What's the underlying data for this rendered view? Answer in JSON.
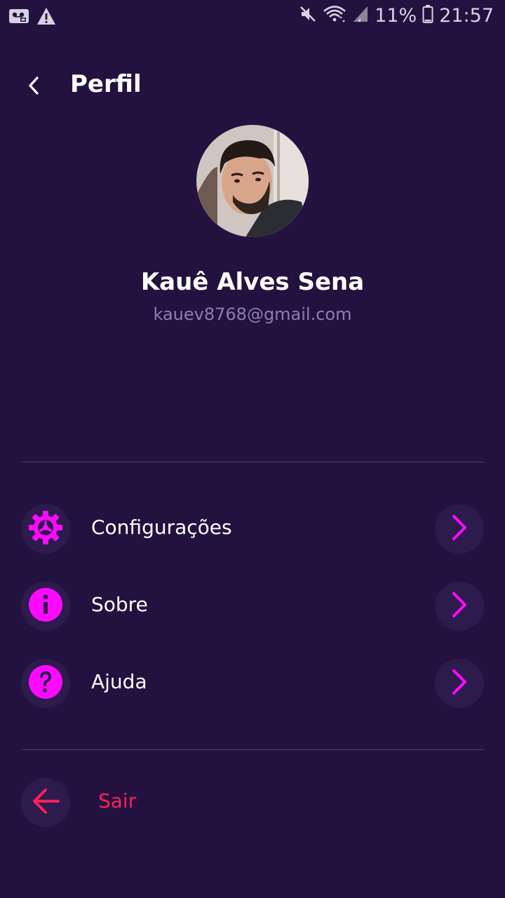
{
  "status_bar": {
    "battery": "11%",
    "time": "21:57",
    "icons": [
      "voicemail-icon",
      "warning-icon",
      "mute-icon",
      "wifi-icon",
      "signal-icon",
      "battery-icon"
    ]
  },
  "header": {
    "title": "Perfil",
    "back_icon": "back-arrow-icon"
  },
  "profile": {
    "name": "Kauê Alves Sena",
    "email": "kauev8768@gmail.com"
  },
  "menu": {
    "items": [
      {
        "label": "Configurações",
        "icon": "gear-icon"
      },
      {
        "label": "Sobre",
        "icon": "info-icon"
      },
      {
        "label": "Ajuda",
        "icon": "help-icon"
      }
    ]
  },
  "logout": {
    "label": "Sair",
    "icon": "arrow-left-icon"
  },
  "colors": {
    "background": "#231240",
    "accent": "#ff0aff",
    "logout": "#ff1f5a",
    "email": "#8c7fae",
    "icon_bg": "#2e1b4d"
  }
}
